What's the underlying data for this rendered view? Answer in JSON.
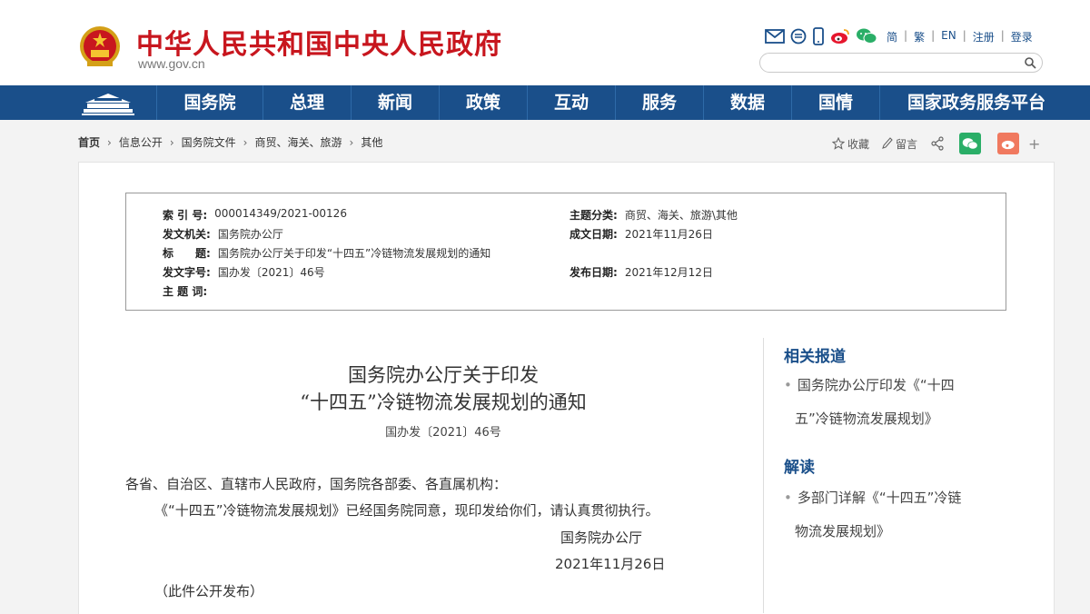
{
  "header": {
    "site_title": "中华人民共和国中央人民政府",
    "site_url": "www.gov.cn",
    "lang_links": [
      "简",
      "繁",
      "EN",
      "注册",
      "登录"
    ],
    "search": {
      "placeholder": ""
    },
    "icons": [
      "mail-icon",
      "message-icon",
      "mobile-icon",
      "weibo-icon",
      "wechat-icon"
    ]
  },
  "nav": {
    "items": [
      "国务院",
      "总理",
      "新闻",
      "政策",
      "互动",
      "服务",
      "数据",
      "国情",
      "国家政务服务平台"
    ]
  },
  "breadcrumb": {
    "items": [
      "首页",
      "信息公开",
      "国务院文件",
      "商贸、海关、旅游",
      "其他"
    ]
  },
  "tools": {
    "favorite": "收藏",
    "comment": "留言",
    "more": "+"
  },
  "meta": {
    "index_label": "索 引 号:",
    "index_value": "000014349/2021-00126",
    "topic_label": "主题分类:",
    "topic_value": "商贸、海关、旅游\\其他",
    "issuer_label": "发文机关:",
    "issuer_value": "国务院办公厅",
    "created_label": "成文日期:",
    "created_value": "2021年11月26日",
    "title_label": "标　　题:",
    "title_value": "国务院办公厅关于印发“十四五”冷链物流发展规划的通知",
    "docno_label": "发文字号:",
    "docno_value": "国办发〔2021〕46号",
    "published_label": "发布日期:",
    "published_value": "2021年12月12日",
    "keywords_label": "主 题 词:"
  },
  "document": {
    "title_line1": "国务院办公厅关于印发",
    "title_line2": "“十四五”冷链物流发展规划的通知",
    "number": "国办发〔2021〕46号",
    "salutation": "各省、自治区、直辖市人民政府，国务院各部委、各直属机构：",
    "paragraph": "《“十四五”冷链物流发展规划》已经国务院同意，现印发给你们，请认真贯彻执行。",
    "signature": "国务院办公厅",
    "date": "2021年11月26日",
    "note": "（此件公开发布）"
  },
  "sidebar": {
    "related_title": "相关报道",
    "related_items": [
      {
        "line1": "国务院办公厅印发《“十四",
        "line2": "五”冷链物流发展规划》"
      }
    ],
    "interpret_title": "解读",
    "interpret_items": [
      {
        "line1": "多部门详解《“十四五”冷链",
        "line2": "物流发展规划》"
      }
    ]
  },
  "colors": {
    "brand_red": "#c8161e",
    "nav_blue": "#1a4f8a",
    "wechat_green": "#2aae67",
    "weibo_red": "#e6162d"
  }
}
